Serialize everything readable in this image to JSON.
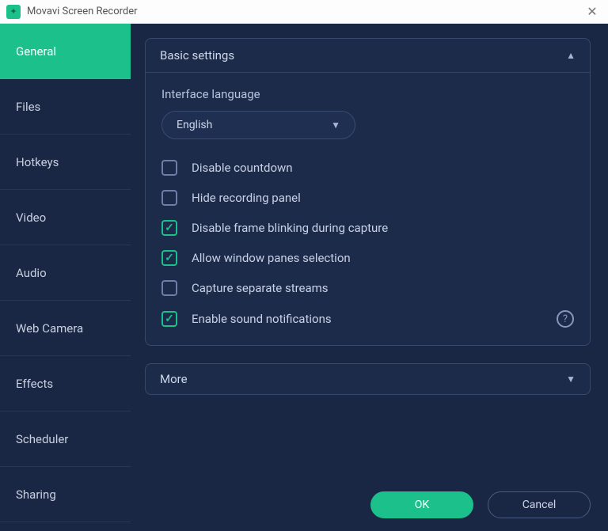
{
  "title": "Movavi Screen Recorder",
  "sidebar": {
    "items": [
      {
        "label": "General",
        "active": true
      },
      {
        "label": "Files",
        "active": false
      },
      {
        "label": "Hotkeys",
        "active": false
      },
      {
        "label": "Video",
        "active": false
      },
      {
        "label": "Audio",
        "active": false
      },
      {
        "label": "Web Camera",
        "active": false
      },
      {
        "label": "Effects",
        "active": false
      },
      {
        "label": "Scheduler",
        "active": false
      },
      {
        "label": "Sharing",
        "active": false
      }
    ]
  },
  "panel": {
    "header": "Basic settings",
    "language_label": "Interface language",
    "language_value": "English",
    "checks": [
      {
        "label": "Disable countdown",
        "checked": false,
        "help": false
      },
      {
        "label": "Hide recording panel",
        "checked": false,
        "help": false
      },
      {
        "label": "Disable frame blinking during capture",
        "checked": true,
        "help": false
      },
      {
        "label": "Allow window panes selection",
        "checked": true,
        "help": false
      },
      {
        "label": "Capture separate streams",
        "checked": false,
        "help": false
      },
      {
        "label": "Enable sound notifications",
        "checked": true,
        "help": true
      }
    ]
  },
  "more_label": "More",
  "buttons": {
    "ok": "OK",
    "cancel": "Cancel"
  }
}
